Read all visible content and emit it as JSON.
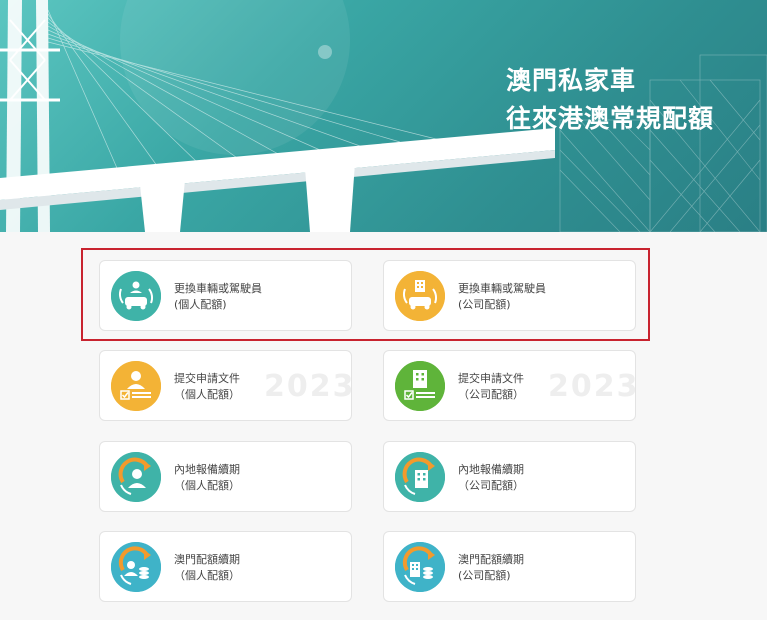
{
  "banner": {
    "title_line1": "澳門私家車",
    "title_line2": "往來港澳常規配額"
  },
  "cards": [
    {
      "line1": "更換車輛或駕駛員",
      "line2": "(個人配額)",
      "icon": "person-car-swap-icon",
      "color": "#3fb3a8"
    },
    {
      "line1": "更換車輛或駕駛員",
      "line2": "(公司配額)",
      "icon": "building-car-swap-icon",
      "color": "#f3b336"
    },
    {
      "line1": "提交申請文件",
      "line2": "（個人配額）",
      "icon": "person-document-icon",
      "color": "#f3b336",
      "watermark": "2023"
    },
    {
      "line1": "提交申請文件",
      "line2": "（公司配額）",
      "icon": "building-document-icon",
      "color": "#5fb43a",
      "watermark": "2023"
    },
    {
      "line1": "內地報備續期",
      "line2": "（個人配額）",
      "icon": "person-renew-icon",
      "color": "#3fb3a8"
    },
    {
      "line1": "內地報備續期",
      "line2": "（公司配額）",
      "icon": "building-renew-icon",
      "color": "#3fb3a8"
    },
    {
      "line1": "澳門配額續期",
      "line2": "（個人配額）",
      "icon": "person-coins-renew-icon",
      "color": "#3fb3c8"
    },
    {
      "line1": "澳門配額續期",
      "line2": "(公司配額)",
      "icon": "building-coins-renew-icon",
      "color": "#3fb3c8"
    }
  ]
}
